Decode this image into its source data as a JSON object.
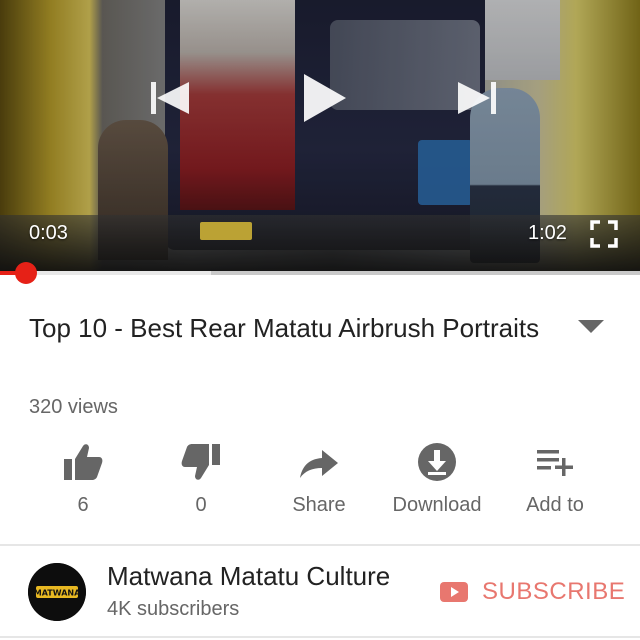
{
  "player": {
    "time_current": "0:03",
    "time_total": "1:02",
    "progress_played": 0.04,
    "progress_buffered": 0.33
  },
  "video": {
    "title": "Top 10 - Best Rear Matatu Airbrush Portraits",
    "views": "320 views"
  },
  "actions": [
    {
      "label": "6",
      "icon": "thumbs-up-icon"
    },
    {
      "label": "0",
      "icon": "thumbs-down-icon"
    },
    {
      "label": "Share",
      "icon": "share-icon"
    },
    {
      "label": "Download",
      "icon": "download-icon"
    },
    {
      "label": "Add to",
      "icon": "playlist-add-icon"
    }
  ],
  "channel": {
    "name": "Matwana Matatu Culture",
    "subscribers": "4K subscribers",
    "avatar_text": "MATWANA",
    "subscribe_label": "SUBSCRIBE"
  },
  "colors": {
    "accent_red": "#e62117",
    "subscribe_text": "#e8776f",
    "icon_gray": "#666666"
  }
}
